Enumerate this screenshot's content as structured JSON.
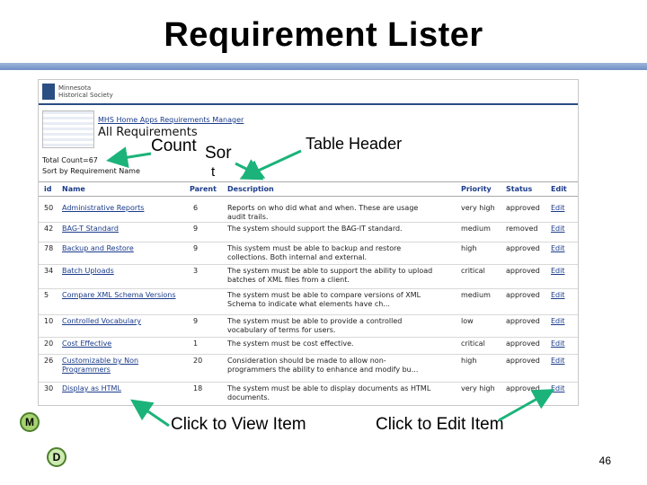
{
  "slide": {
    "title": "Requirement Lister",
    "page_number": "46",
    "badges": [
      "M",
      "D"
    ]
  },
  "annotations": {
    "count": "Count",
    "sort": "Sor",
    "sort_cont": "t",
    "table_header": "Table Header",
    "view_item": "Click to View Item",
    "edit_item": "Click to Edit Item"
  },
  "app": {
    "logo_lines": [
      "Minnesota",
      "Historical Society"
    ],
    "breadcrumb": "MHS Home Apps Requirements Manager",
    "heading": "All Requirements",
    "total_count": "Total Count=67",
    "sort_by": "Sort by Requirement Name"
  },
  "table": {
    "headers": [
      "id",
      "Name",
      "Parent",
      "Description",
      "Priority",
      "Status",
      "Edit"
    ],
    "rows": [
      {
        "id": "50",
        "name": "Administrative Reports",
        "parent": "6",
        "description": "Reports on who did what and when. These are usage audit trails.",
        "priority": "very high",
        "status": "approved",
        "edit": "Edit"
      },
      {
        "id": "42",
        "name": "BAG-T Standard",
        "parent": "9",
        "description": "The system should support the BAG-IT standard.",
        "priority": "medium",
        "status": "removed",
        "edit": "Edit"
      },
      {
        "id": "78",
        "name": "Backup and Restore",
        "parent": "9",
        "description": "This system must be able to backup and restore collections. Both internal and external.",
        "priority": "high",
        "status": "approved",
        "edit": "Edit"
      },
      {
        "id": "34",
        "name": "Batch Uploads",
        "parent": "3",
        "description": "The system must be able to support the ability to upload batches of XML files from a client.",
        "priority": "critical",
        "status": "approved",
        "edit": "Edit"
      },
      {
        "id": "5",
        "name": "Compare XML Schema Versions",
        "parent": "",
        "description": "The system must be able to compare versions of XML Schema to indicate what elements have ch...",
        "priority": "medium",
        "status": "approved",
        "edit": "Edit"
      },
      {
        "id": "10",
        "name": "Controlled Vocabulary",
        "parent": "9",
        "description": "The system must be able to provide a controlled vocabulary of terms for users.",
        "priority": "low",
        "status": "approved",
        "edit": "Edit"
      },
      {
        "id": "20",
        "name": "Cost Effective",
        "parent": "1",
        "description": "The system must be cost effective.",
        "priority": "critical",
        "status": "approved",
        "edit": "Edit"
      },
      {
        "id": "26",
        "name": "Customizable by Non Programmers",
        "parent": "20",
        "description": "Consideration should be made to allow non-programmers the ability to enhance and modify bu...",
        "priority": "high",
        "status": "approved",
        "edit": "Edit"
      },
      {
        "id": "30",
        "name": "Display as HTML",
        "parent": "18",
        "description": "The system must be able to display documents as HTML documents.",
        "priority": "very high",
        "status": "approved",
        "edit": "Edit"
      }
    ]
  },
  "colors": {
    "accent_blue": "#2b4e83",
    "link": "#1a3b8a",
    "arrow_green": "#1bb37a",
    "badge_green": "#a6d36f"
  }
}
